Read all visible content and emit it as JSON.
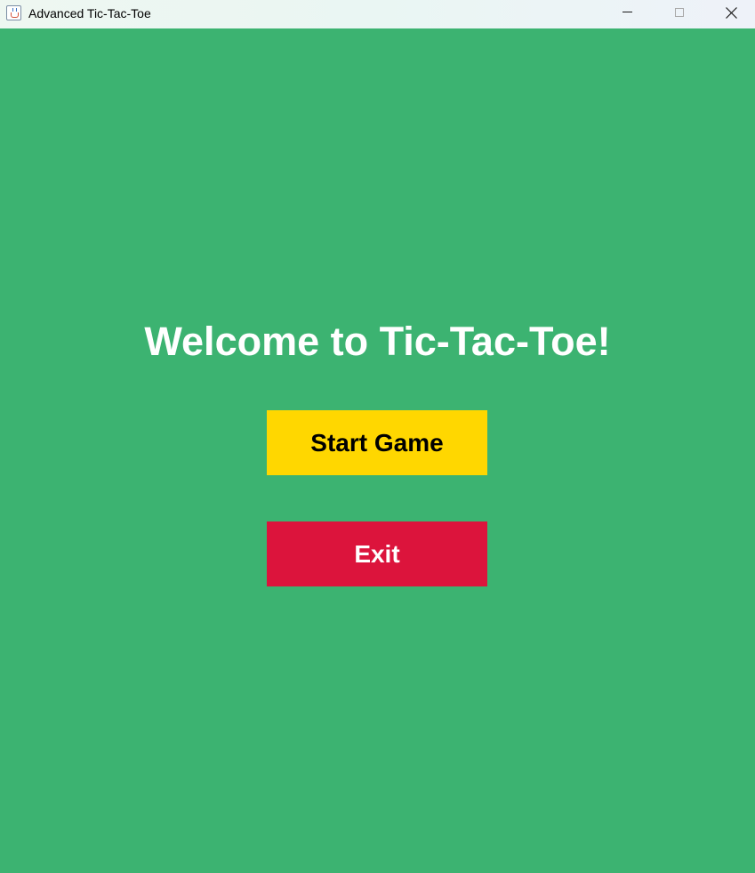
{
  "window": {
    "title": "Advanced Tic-Tac-Toe",
    "icon": "java-coffee-cup-icon",
    "controls": [
      "minimize-icon",
      "maximize-icon",
      "close-icon"
    ]
  },
  "main": {
    "welcome_text": "Welcome to Tic-Tac-Toe!",
    "start_button_label": "Start Game",
    "exit_button_label": "Exit"
  },
  "colors": {
    "background": "#3cb371",
    "start_button": "#ffd700",
    "exit_button": "#dc143c",
    "welcome_text": "#ffffff"
  }
}
